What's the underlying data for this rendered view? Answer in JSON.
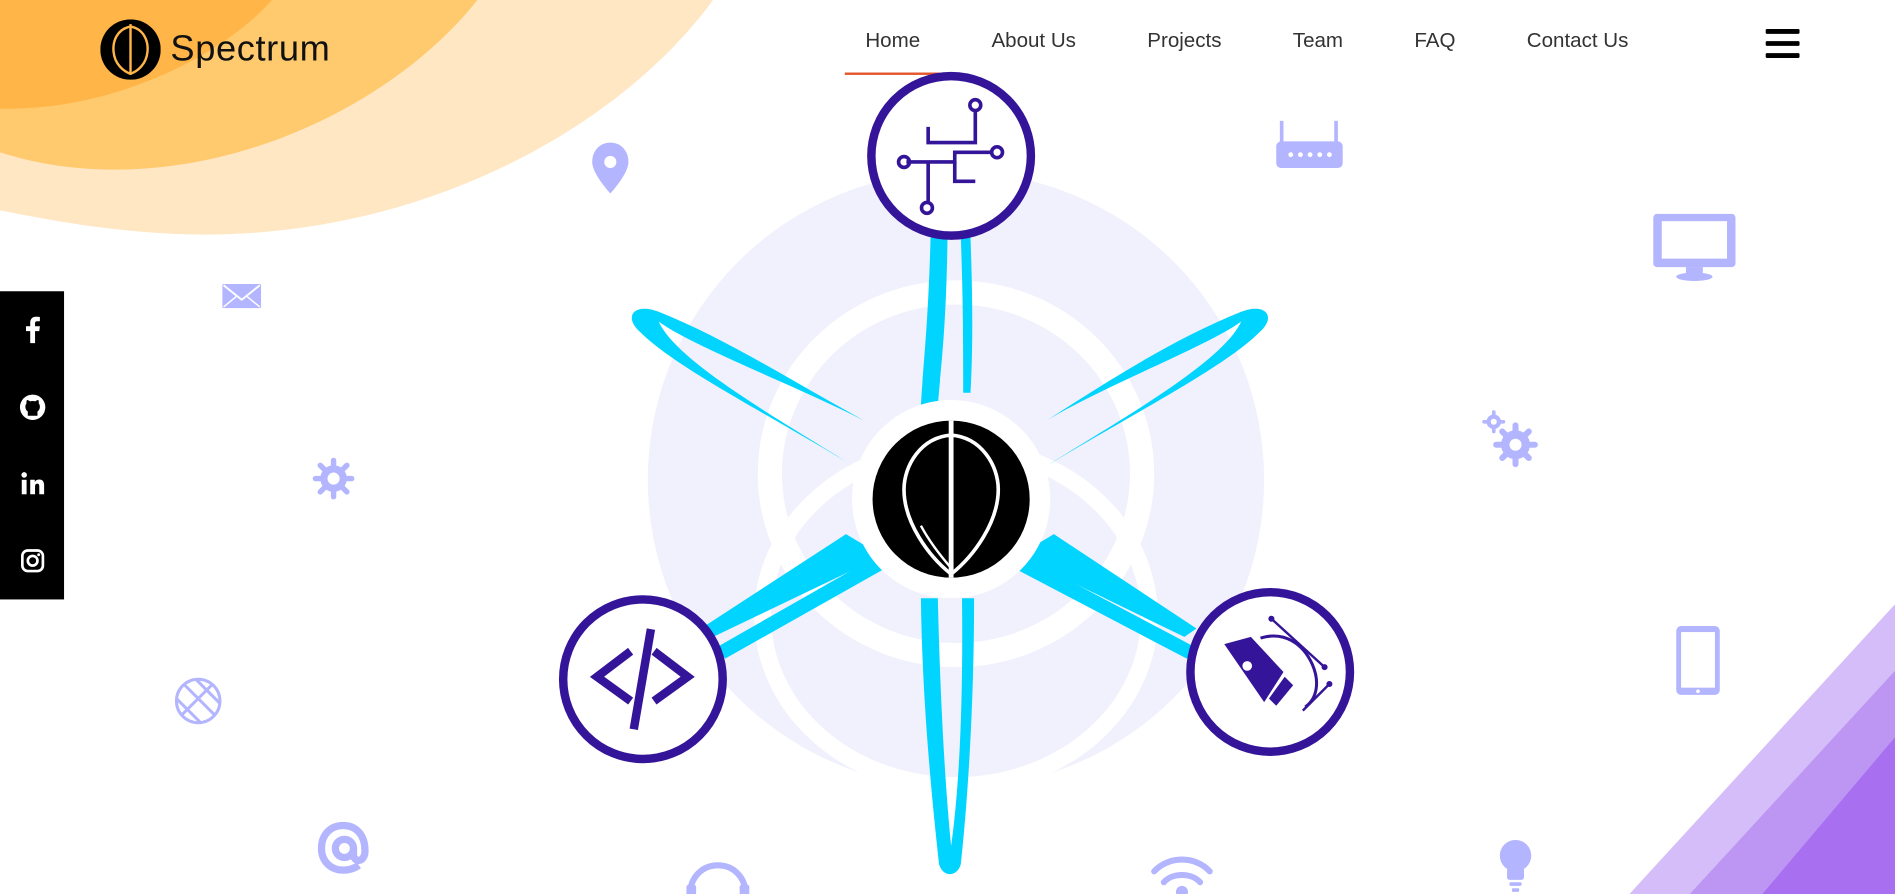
{
  "brand": {
    "name": "Spectrum"
  },
  "nav": {
    "items": [
      {
        "label": "Home",
        "active": true
      },
      {
        "label": "About Us",
        "active": false
      },
      {
        "label": "Projects",
        "active": false
      },
      {
        "label": "Team",
        "active": false
      },
      {
        "label": "FAQ",
        "active": false
      },
      {
        "label": "Contact Us",
        "active": false
      }
    ]
  },
  "social": [
    "facebook-icon",
    "github-icon",
    "linkedin-icon",
    "instagram-icon"
  ],
  "colors": {
    "accent_orange": "#ffb547",
    "nav_active_underline": "#e4572e",
    "node_purple": "#341499",
    "petal_cyan": "#00d4ff",
    "deco_lavender": "#b3b5ff",
    "corner_purple": "#a86ff0"
  },
  "hero": {
    "nodes": [
      "circuit-icon",
      "code-icon",
      "pen-tool-icon"
    ],
    "center": "spectrum-logo-icon"
  },
  "floating_icons": [
    "location-pin-icon",
    "router-icon",
    "monitor-icon",
    "mail-icon",
    "gear-icon",
    "gears-icon",
    "globe-icon",
    "tablet-icon",
    "at-sign-icon",
    "headphones-icon",
    "wifi-icon",
    "lightbulb-icon"
  ]
}
